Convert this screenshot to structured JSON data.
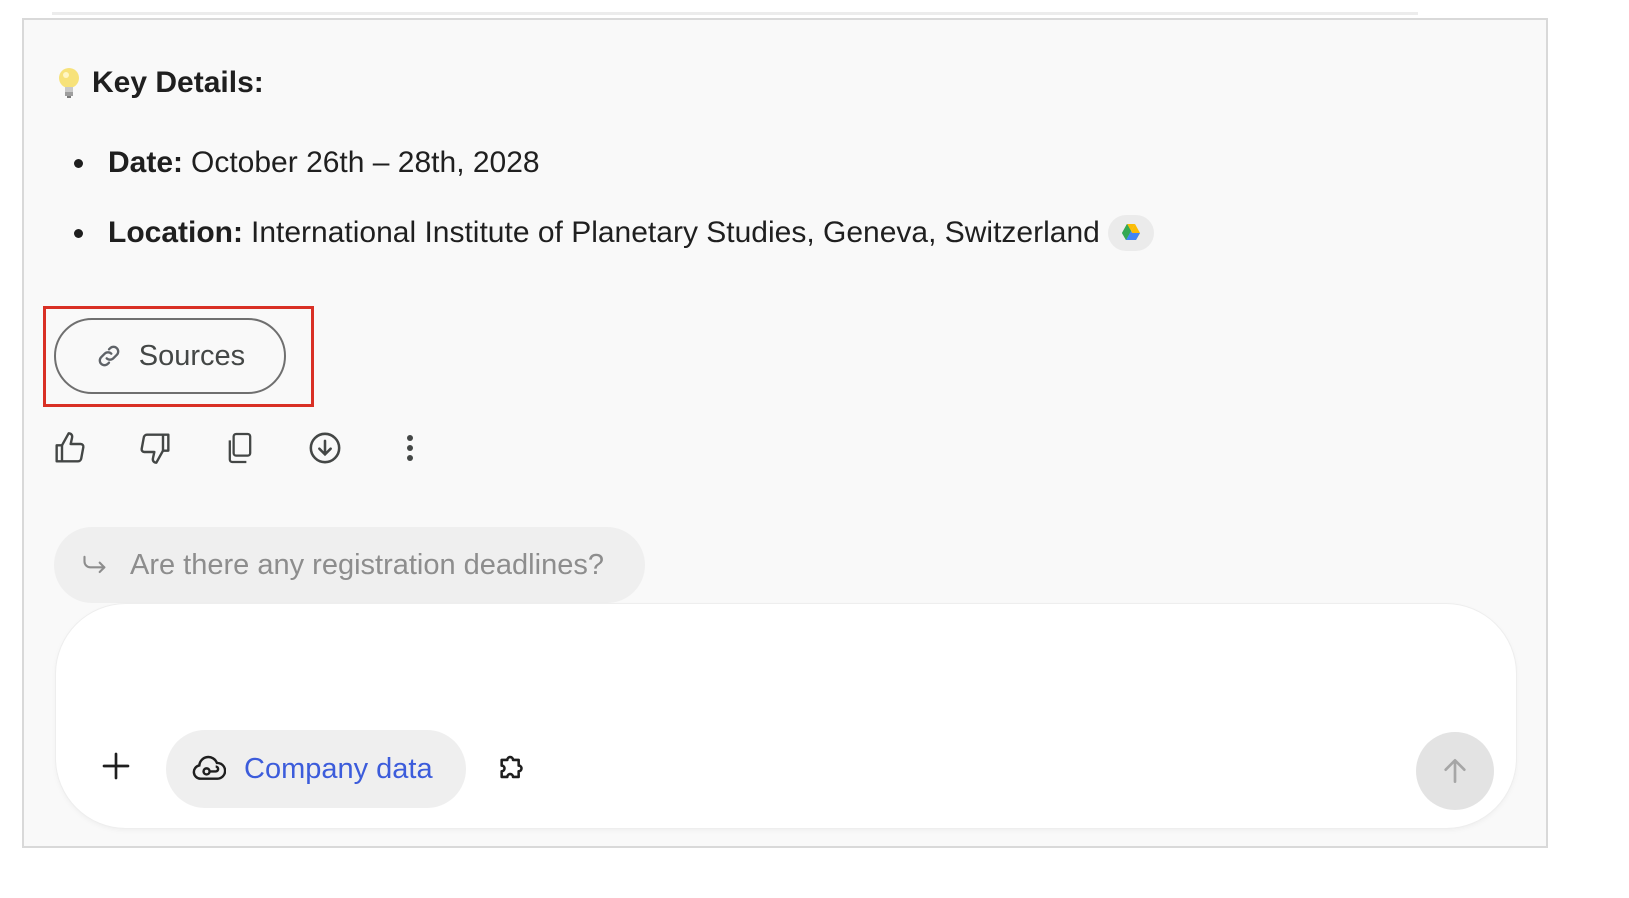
{
  "response": {
    "heading": "Key Details:",
    "details": [
      {
        "label": "Date:",
        "value": "October 26th – 28th, 2028"
      },
      {
        "label": "Location:",
        "value": "International Institute of Planetary Studies, Geneva, Switzerland"
      }
    ],
    "sources_label": "Sources"
  },
  "actions": [
    "thumbs-up",
    "thumbs-down",
    "copy",
    "download",
    "more"
  ],
  "suggestion": {
    "text": "Are there any registration deadlines?"
  },
  "composer": {
    "placeholder": "",
    "company_data_label": "Company data"
  },
  "colors": {
    "accent": "#3c5cdb",
    "highlight": "#d93025",
    "send_disabled": "#e3e3e3"
  }
}
